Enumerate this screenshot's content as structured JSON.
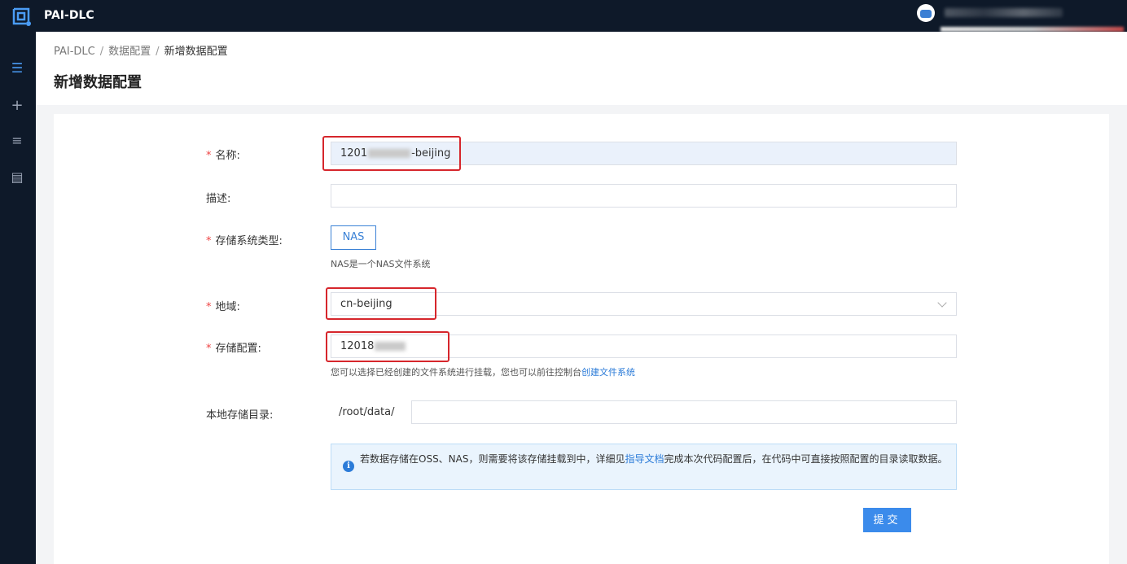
{
  "app": {
    "title": "PAI-DLC"
  },
  "breadcrumb": {
    "items": [
      "PAI-DLC",
      "数据配置",
      "新增数据配置"
    ],
    "separator": "/"
  },
  "page": {
    "title": "新增数据配置"
  },
  "form": {
    "name": {
      "label": "名称:",
      "value_prefix": "1201",
      "value_suffix": "-beijing"
    },
    "description": {
      "label": "描述:",
      "value": ""
    },
    "storage_type": {
      "label": "存储系统类型:",
      "option": "NAS",
      "hint": "NAS是一个NAS文件系统"
    },
    "region": {
      "label": "地域:",
      "value": "cn-beijing"
    },
    "storage_config": {
      "label": "存储配置:",
      "value_prefix": "12018",
      "hint": "您可以选择已经创建的文件系统进行挂载，您也可以前往控制台",
      "hint_link": "创建文件系统"
    },
    "local_dir": {
      "label": "本地存储目录:",
      "prefix": "/root/data/",
      "value": ""
    }
  },
  "alert": {
    "text_before": "若数据存储在OSS、NAS，则需要将该存储挂载到中，详细见",
    "link": "指导文档",
    "text_after": "完成本次代码配置后，在代码中可直接按照配置的目录读取数据。"
  },
  "submit": {
    "label": "提交"
  },
  "colors": {
    "nav_bg": "#0e1929",
    "accent": "#3b82d6",
    "required": "#e44444",
    "highlight_box": "#d6262c"
  },
  "icons": [
    "logo-icon",
    "menu-collapse-icon",
    "plus-icon",
    "list-icon",
    "document-icon",
    "info-icon",
    "chevron-down-icon"
  ]
}
